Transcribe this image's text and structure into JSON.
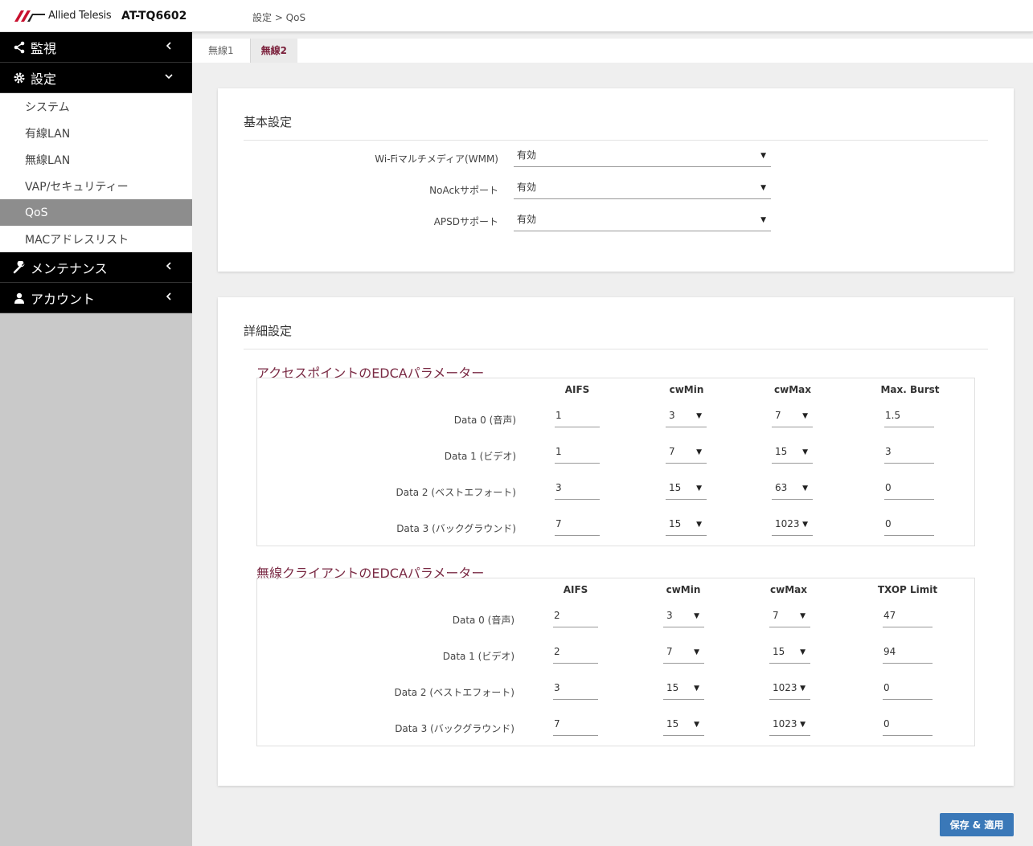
{
  "header": {
    "brand": "Allied Telesis",
    "model": "AT-TQ6602",
    "breadcrumb": "設定 > QoS"
  },
  "sidebar": {
    "monitor": "監視",
    "settings": "設定",
    "sub_items": [
      "システム",
      "有線LAN",
      "無線LAN",
      "VAP/セキュリティー",
      "QoS",
      "MACアドレスリスト"
    ],
    "maintenance": "メンテナンス",
    "account": "アカウント"
  },
  "tabs": [
    "無線1",
    "無線2"
  ],
  "basic": {
    "title": "基本設定",
    "fields": [
      {
        "label": "Wi-Fiマルチメディア(WMM)",
        "value": "有効"
      },
      {
        "label": "NoAckサポート",
        "value": "有効"
      },
      {
        "label": "APSDサポート",
        "value": "有効"
      }
    ]
  },
  "advanced": {
    "title": "詳細設定",
    "ap": {
      "title": "アクセスポイントのEDCAパラメーター",
      "headers": [
        "AIFS",
        "cwMin",
        "cwMax",
        "Max. Burst"
      ],
      "rows": [
        {
          "label": "Data 0 (音声)",
          "aifs": "1",
          "cwmin": "3",
          "cwmax": "7",
          "last": "1.5"
        },
        {
          "label": "Data 1 (ビデオ)",
          "aifs": "1",
          "cwmin": "7",
          "cwmax": "15",
          "last": "3"
        },
        {
          "label": "Data 2 (ベストエフォート)",
          "aifs": "3",
          "cwmin": "15",
          "cwmax": "63",
          "last": "0"
        },
        {
          "label": "Data 3 (バックグラウンド)",
          "aifs": "7",
          "cwmin": "15",
          "cwmax": "1023",
          "last": "0"
        }
      ]
    },
    "client": {
      "title": "無線クライアントのEDCAパラメーター",
      "headers": [
        "AIFS",
        "cwMin",
        "cwMax",
        "TXOP Limit"
      ],
      "rows": [
        {
          "label": "Data 0 (音声)",
          "aifs": "2",
          "cwmin": "3",
          "cwmax": "7",
          "last": "47"
        },
        {
          "label": "Data 1 (ビデオ)",
          "aifs": "2",
          "cwmin": "7",
          "cwmax": "15",
          "last": "94"
        },
        {
          "label": "Data 2 (ベストエフォート)",
          "aifs": "3",
          "cwmin": "15",
          "cwmax": "1023",
          "last": "0"
        },
        {
          "label": "Data 3 (バックグラウンド)",
          "aifs": "7",
          "cwmin": "15",
          "cwmax": "1023",
          "last": "0"
        }
      ]
    }
  },
  "save_label": "保存 & 適用",
  "colors": {
    "accent_title": "#7a2a44",
    "button": "#3a78b8",
    "sidebar_dark": "#000000"
  }
}
